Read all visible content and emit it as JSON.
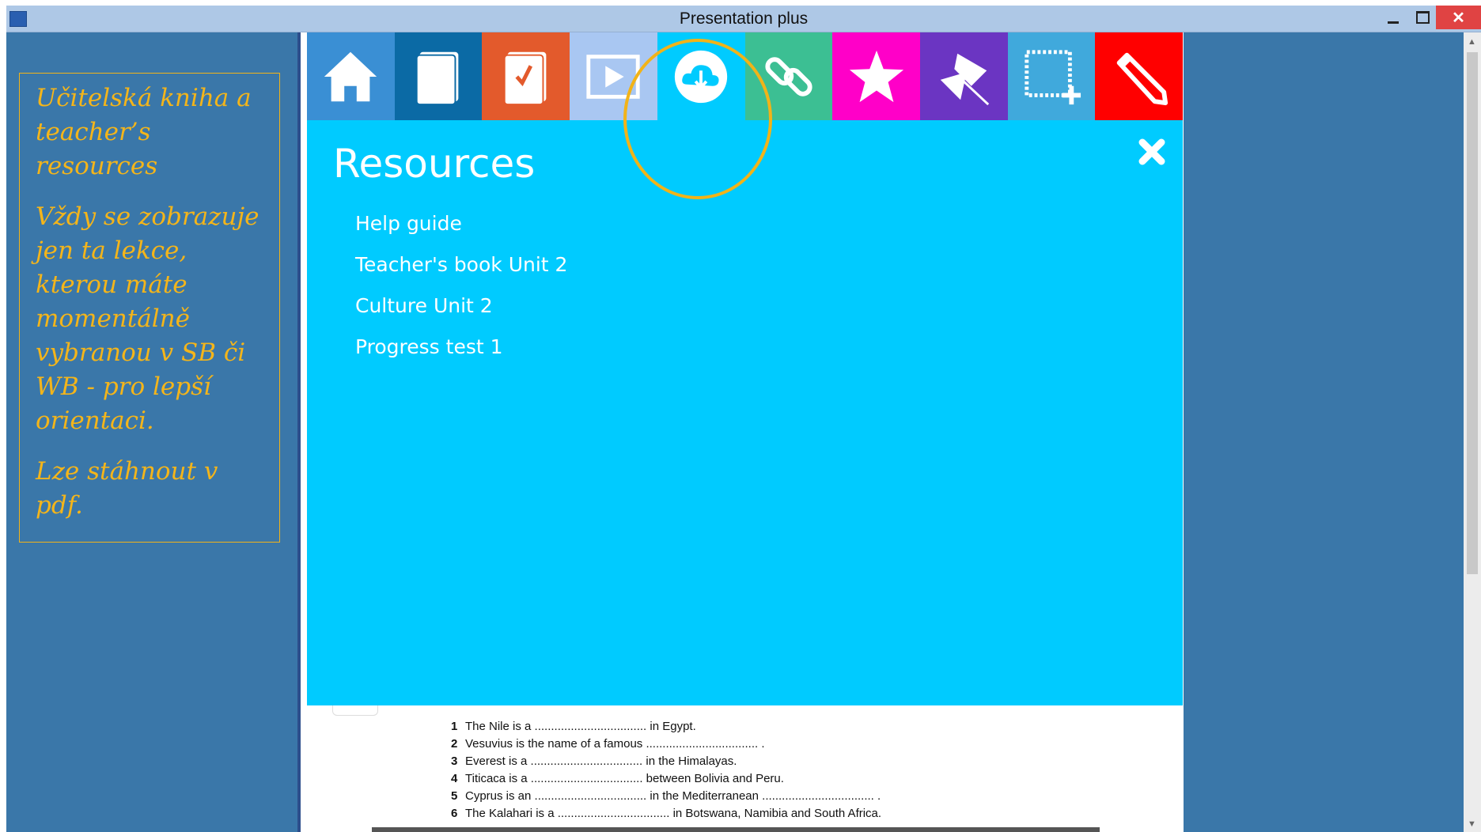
{
  "window": {
    "title": "Presentation plus",
    "minimize_label": "",
    "close_label": "✕"
  },
  "annotation": {
    "paragraphs": [
      "Učitelská kniha a teacher’s resources",
      "Vždy se zobrazuje jen ta lekce, kterou máte momentálně vybranou v SB či WB - pro lepší orientaci.",
      "Lze stáhnout v pdf."
    ],
    "color": "#f4b51a"
  },
  "toolbar": {
    "tools": [
      {
        "name": "home",
        "icon": "home-icon",
        "color": "#3a8fd4"
      },
      {
        "name": "book",
        "icon": "book-icon",
        "color": "#0b6aa5"
      },
      {
        "name": "workbook",
        "icon": "workbook-icon",
        "color": "#e35a2c"
      },
      {
        "name": "media",
        "icon": "play-icon",
        "color": "#a9c7f2"
      },
      {
        "name": "resources",
        "icon": "cloud-download-icon",
        "color": "#00cbff"
      },
      {
        "name": "links",
        "icon": "link-icon",
        "color": "#3cbf93"
      },
      {
        "name": "favourites",
        "icon": "star-icon",
        "color": "#ff00c8"
      },
      {
        "name": "pins",
        "icon": "pin-icon",
        "color": "#6b35c2"
      },
      {
        "name": "select-area",
        "icon": "select-area-icon",
        "color": "#40a9dc"
      },
      {
        "name": "pen",
        "icon": "pencil-icon",
        "color": "#ff0000"
      }
    ]
  },
  "resources_panel": {
    "title": "Resources",
    "items": [
      "Help guide",
      "Teacher's book Unit 2",
      "Culture Unit 2",
      "Progress test 1"
    ],
    "background": "#00cbff"
  },
  "exercise": {
    "lines": [
      {
        "num": "1",
        "text": "The Nile is a .................................. in Egypt."
      },
      {
        "num": "2",
        "text": "Vesuvius is the name of a famous .................................. ."
      },
      {
        "num": "3",
        "text": "Everest is a .................................. in the Himalayas."
      },
      {
        "num": "4",
        "text": "Titicaca is a .................................. between Bolivia and Peru."
      },
      {
        "num": "5",
        "text": "Cyprus is an .................................. in the Mediterranean .................................. ."
      },
      {
        "num": "6",
        "text": "The Kalahari is a .................................. in Botswana, Namibia and South Africa."
      }
    ]
  },
  "highlight_color": "#f2b318"
}
